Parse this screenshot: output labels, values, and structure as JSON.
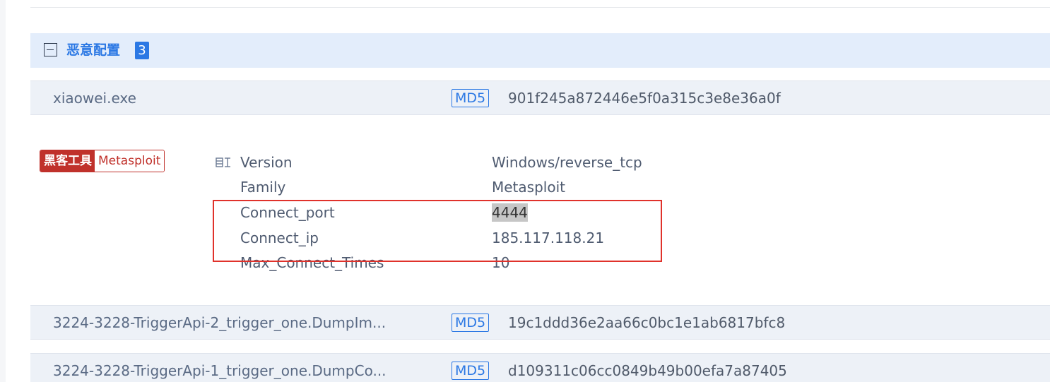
{
  "section": {
    "title": "恶意配置",
    "count": "3"
  },
  "files": [
    {
      "name": "xiaowei.exe",
      "md5_label": "MD5",
      "md5": "901f245a872446e5f0a315c3e8e36a0f"
    },
    {
      "name": "3224-3228-TriggerApi-2_trigger_one.DumpIm...",
      "md5_label": "MD5",
      "md5": "19c1ddd36e2aa66c0bc1e1ab6817bfc8"
    },
    {
      "name": "3224-3228-TriggerApi-1_trigger_one.DumpCo...",
      "md5_label": "MD5",
      "md5": "d109311c06cc0849b49b00efa7a87405"
    }
  ],
  "tag": {
    "category": "黑客工具",
    "name": "Metasploit"
  },
  "config": [
    {
      "key": "Version",
      "value": "Windows/reverse_tcp"
    },
    {
      "key": "Family",
      "value": "Metasploit"
    },
    {
      "key": "Connect_port",
      "value": "4444"
    },
    {
      "key": "Connect_ip",
      "value": "185.117.118.21"
    },
    {
      "key": "Max_Connect_Times",
      "value": "10"
    }
  ],
  "colors": {
    "accent": "#2b78e4",
    "header_bg": "#e3edfb",
    "row_bg": "#edf1f7",
    "danger": "#c0312b",
    "annotation_red": "#e0322b"
  },
  "icons": {
    "collapse": "minus-square-icon",
    "config": "config-list-icon"
  }
}
